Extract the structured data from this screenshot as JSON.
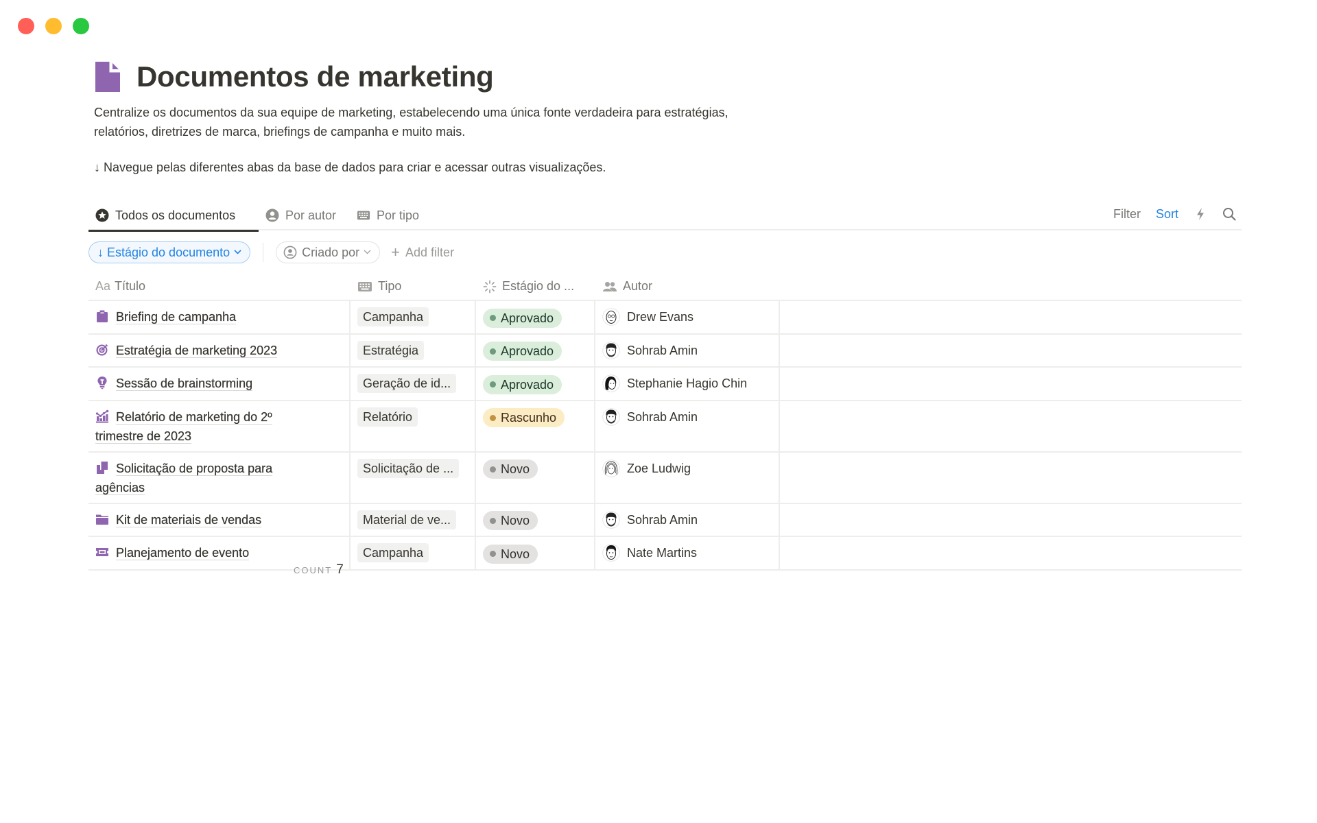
{
  "window": {
    "controls": [
      {
        "name": "close",
        "color": "#ff5f57"
      },
      {
        "name": "minimize",
        "color": "#febc2e"
      },
      {
        "name": "zoom",
        "color": "#28c840"
      }
    ]
  },
  "page": {
    "icon": "document-icon",
    "icon_color": "#9065b0",
    "title": "Documentos de marketing",
    "description_line1": "Centralize os documentos da sua equipe de marketing, estabelecendo uma única fonte verdadeira para estratégias,",
    "description_line2": "relatórios, diretrizes de marca, briefings de campanha e muito mais.",
    "hint": "↓ Navegue pelas diferentes abas da base de dados para criar e acessar outras visualizações."
  },
  "tabs": [
    {
      "label": "Todos os documentos",
      "icon": "star-circle-icon",
      "active": true
    },
    {
      "label": "Por autor",
      "icon": "person-circle-icon",
      "active": false
    },
    {
      "label": "Por tipo",
      "icon": "keyboard-icon",
      "active": false
    }
  ],
  "actions": {
    "filter_label": "Filter",
    "sort_label": "Sort",
    "automation_icon": "lightning-icon",
    "search_icon": "search-icon"
  },
  "filters": {
    "sort_chip": {
      "arrow": "↓",
      "label": "Estágio do documento"
    },
    "criado_chip": {
      "label": "Criado por"
    },
    "add_filter_label": "Add filter"
  },
  "table": {
    "columns": [
      {
        "key": "titulo",
        "label": "Título",
        "icon_text": "Aa"
      },
      {
        "key": "tipo",
        "label": "Tipo",
        "icon": "keyboard-icon"
      },
      {
        "key": "estagio",
        "label": "Estágio do ...",
        "icon": "status-spinner-icon"
      },
      {
        "key": "autor",
        "label": "Autor",
        "icon": "people-icon"
      }
    ],
    "rows": [
      {
        "icon": "clipboard-icon",
        "title": "Briefing de campanha",
        "tipo": "Campanha",
        "estagio": "Aprovado",
        "autor": "Drew Evans"
      },
      {
        "icon": "target-icon",
        "title": "Estratégia de marketing 2023",
        "tipo": "Estratégia",
        "estagio": "Aprovado",
        "autor": "Sohrab Amin"
      },
      {
        "icon": "lightbulb-icon",
        "title": "Sessão de brainstorming",
        "tipo": "Geração de id...",
        "estagio": "Aprovado",
        "autor": "Stephanie Hagio Chin"
      },
      {
        "icon": "chart-icon",
        "title": "Relatório de marketing do 2º trimestre de 2023",
        "tipo": "Relatório",
        "estagio": "Rascunho",
        "autor": "Sohrab Amin"
      },
      {
        "icon": "copy-documents-icon",
        "title": "Solicitação de proposta para agências",
        "tipo": "Solicitação de ...",
        "estagio": "Novo",
        "autor": "Zoe Ludwig"
      },
      {
        "icon": "folder-icon",
        "title": "Kit de materiais de vendas",
        "tipo": "Material de ve...",
        "estagio": "Novo",
        "autor": "Sohrab Amin"
      },
      {
        "icon": "ticket-icon",
        "title": "Planejamento de evento",
        "tipo": "Campanha",
        "estagio": "Novo",
        "autor": "Nate Martins"
      }
    ],
    "status_colors": {
      "Aprovado": {
        "bg": "#dbeddb",
        "dot": "#6c9b7d",
        "text": "#1c3829"
      },
      "Rascunho": {
        "bg": "#fbecc4",
        "dot": "#c29243",
        "text": "#402c1b"
      },
      "Novo": {
        "bg": "#e3e2e0",
        "dot": "#91918e",
        "text": "#32302c"
      }
    },
    "count_label": "COUNT",
    "count_value": "7"
  }
}
